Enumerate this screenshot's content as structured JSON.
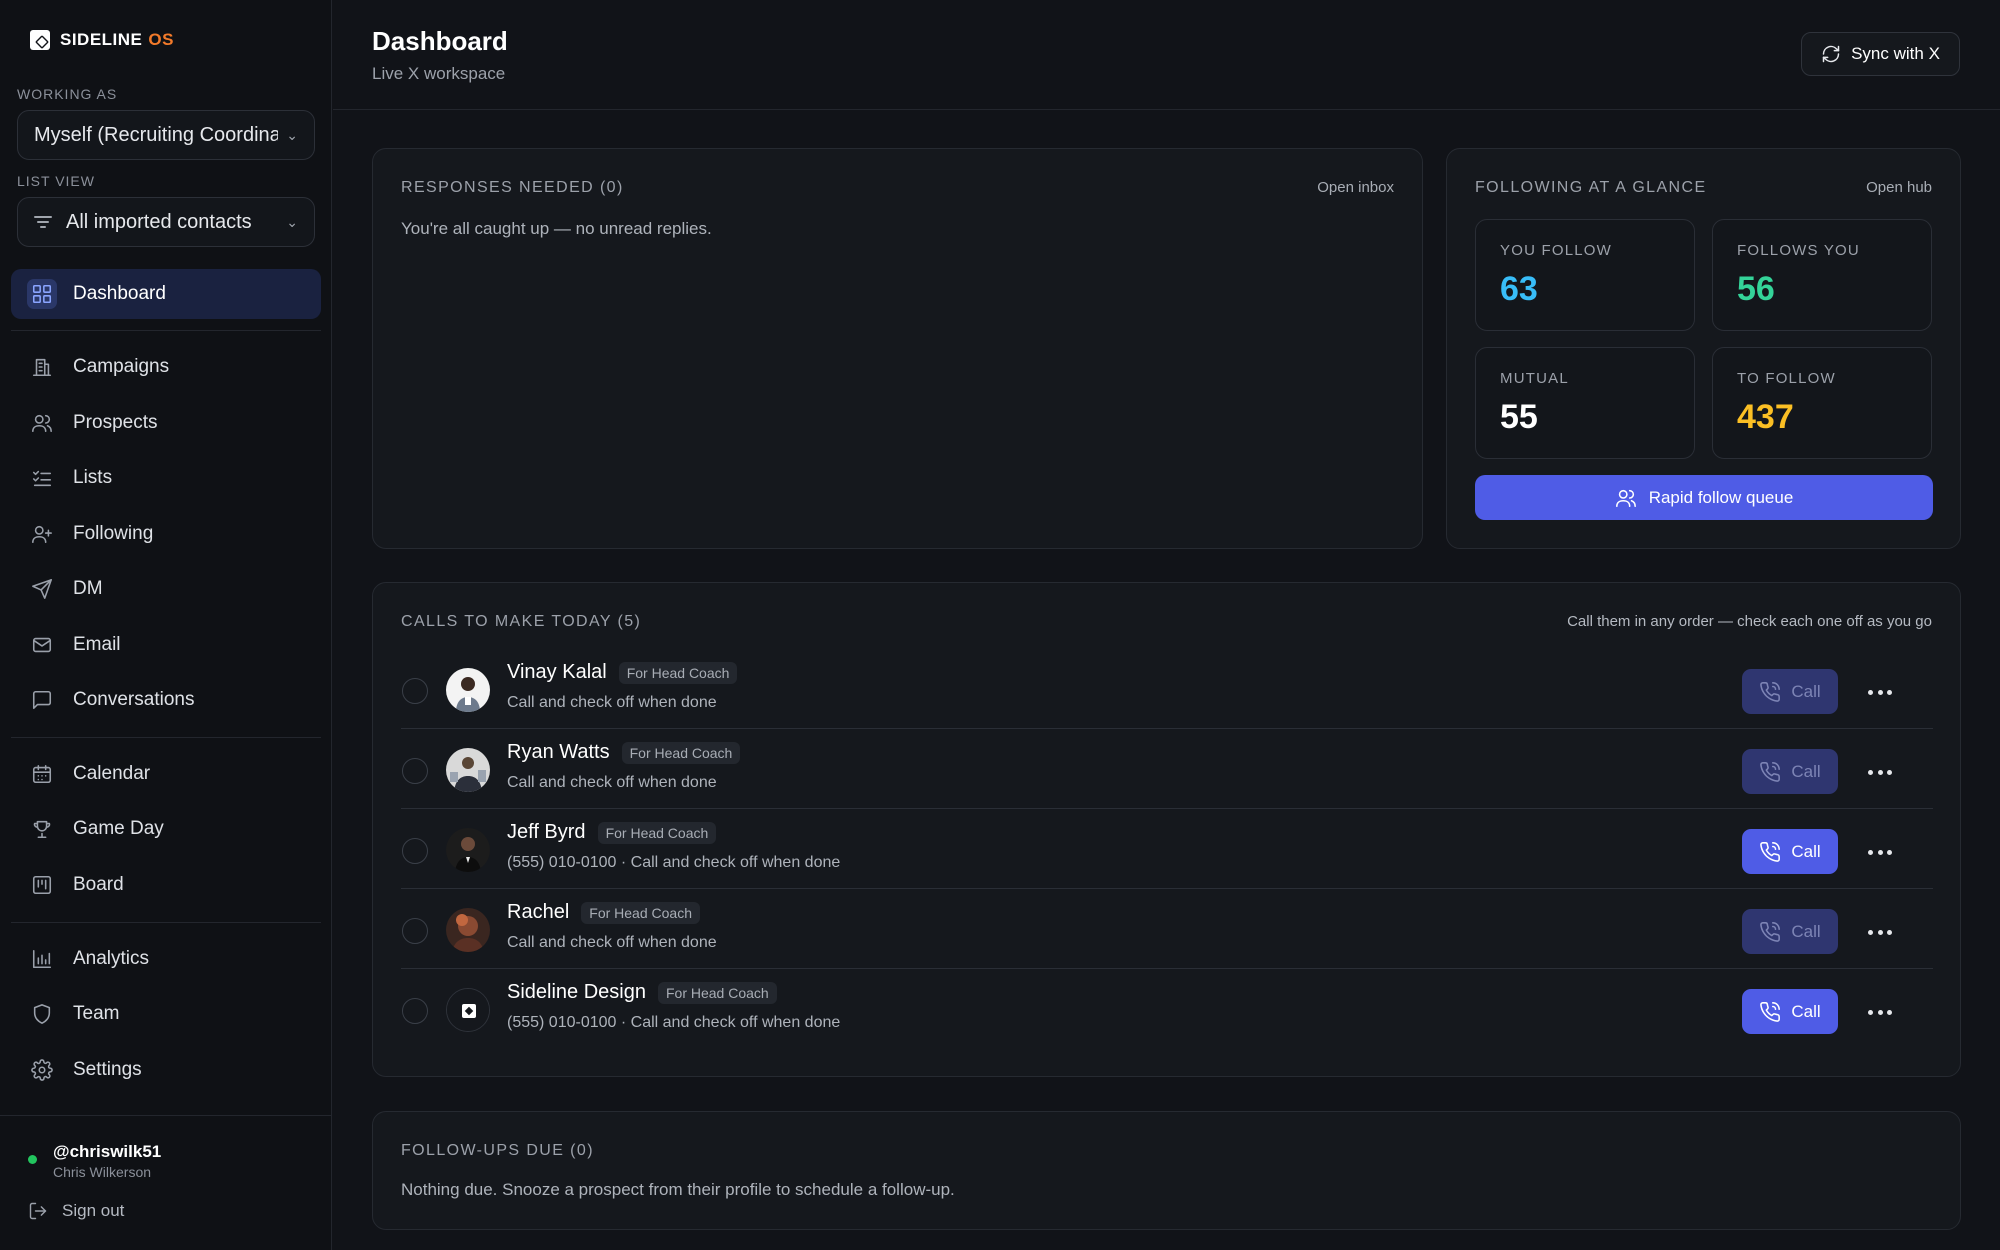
{
  "brand": {
    "name": "SIDELINE",
    "suffix": "OS"
  },
  "sidebar": {
    "working_as_label": "WORKING AS",
    "working_as_value": "Myself (Recruiting Coordina",
    "list_view_label": "LIST VIEW",
    "list_view_value": "All imported contacts",
    "items": [
      {
        "label": "Dashboard",
        "icon": "dashboard-icon",
        "active": true
      },
      {
        "label": "Campaigns",
        "icon": "building-icon"
      },
      {
        "label": "Prospects",
        "icon": "users-icon"
      },
      {
        "label": "Lists",
        "icon": "list-check-icon"
      },
      {
        "label": "Following",
        "icon": "user-plus-icon"
      },
      {
        "label": "DM",
        "icon": "send-icon"
      },
      {
        "label": "Email",
        "icon": "mail-icon"
      },
      {
        "label": "Conversations",
        "icon": "message-square-icon"
      },
      {
        "label": "Calendar",
        "icon": "calendar-icon"
      },
      {
        "label": "Game Day",
        "icon": "trophy-icon"
      },
      {
        "label": "Board",
        "icon": "kanban-icon"
      },
      {
        "label": "Analytics",
        "icon": "bar-chart-icon"
      },
      {
        "label": "Team",
        "icon": "shield-icon"
      },
      {
        "label": "Settings",
        "icon": "gear-icon"
      }
    ],
    "user": {
      "handle": "@chriswilk51",
      "name": "Chris Wilkerson",
      "status_color": "#22c55e"
    },
    "sign_out": "Sign out"
  },
  "header": {
    "title": "Dashboard",
    "subtitle": "Live X workspace",
    "sync_label": "Sync with X"
  },
  "responses": {
    "title": "RESPONSES NEEDED (0)",
    "link": "Open inbox",
    "empty": "You're all caught up — no unread replies."
  },
  "following": {
    "title": "FOLLOWING AT A GLANCE",
    "link": "Open hub",
    "stats": [
      {
        "label": "YOU FOLLOW",
        "value": "63",
        "color": "#38bdf8"
      },
      {
        "label": "FOLLOWS YOU",
        "value": "56",
        "color": "#34d399"
      },
      {
        "label": "MUTUAL",
        "value": "55",
        "color": "#ffffff"
      },
      {
        "label": "TO FOLLOW",
        "value": "437",
        "color": "#fbbf24"
      }
    ],
    "button": "Rapid follow queue"
  },
  "calls": {
    "title": "CALLS TO MAKE TODAY (5)",
    "hint": "Call them in any order — check each one off as you go",
    "call_label": "Call",
    "rows": [
      {
        "name": "Vinay Kalal",
        "tag": "For Head Coach",
        "sub": "Call and check off when done",
        "enabled": false
      },
      {
        "name": "Ryan Watts",
        "tag": "For Head Coach",
        "sub": "Call and check off when done",
        "enabled": false
      },
      {
        "name": "Jeff Byrd",
        "tag": "For Head Coach",
        "sub": "(555) 010-0100 · Call and check off when done",
        "enabled": true
      },
      {
        "name": "Rachel",
        "tag": "For Head Coach",
        "sub": "Call and check off when done",
        "enabled": false
      },
      {
        "name": "Sideline Design",
        "tag": "For Head Coach",
        "sub": "(555) 010-0100 · Call and check off when done",
        "enabled": true
      }
    ]
  },
  "followups": {
    "title": "FOLLOW-UPS DUE (0)",
    "empty": "Nothing due. Snooze a prospect from their profile to schedule a follow-up."
  },
  "colors": {
    "accent": "#4f5ce6",
    "background": "#111318",
    "brand_os": "#f27a2a"
  }
}
